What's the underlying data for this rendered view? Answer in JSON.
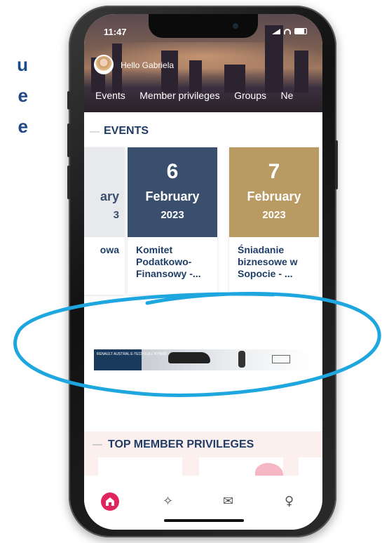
{
  "side_text": [
    "u",
    "e",
    "e"
  ],
  "status": {
    "time": "11:47"
  },
  "header": {
    "greeting": "Hello Gabriela"
  },
  "nav": [
    "Events",
    "Member privileges",
    "Groups",
    "Ne"
  ],
  "events": {
    "title": "EVENTS",
    "cards": [
      {
        "day": "",
        "month": "ary",
        "year": "3",
        "title": "owa",
        "bg": "#e8e9ec"
      },
      {
        "day": "6",
        "month": "February",
        "year": "2023",
        "title": "Komitet Podatkowo-Finansowy -...",
        "bg": "#3a4f6e"
      },
      {
        "day": "7",
        "month": "February",
        "year": "2023",
        "title": "Śniadanie biznesowe w Sopocie - ...",
        "bg": "#b89a62"
      }
    ]
  },
  "ad": {
    "text": "RENAULT AUSTRAL E-TECH FULL HYBRID"
  },
  "privileges": {
    "title": "TOP MEMBER PRIVILEGES"
  },
  "tabs": [
    "home-icon",
    "network-icon",
    "mail-icon",
    "user-icon"
  ],
  "colors": {
    "accent": "#e0245e",
    "navy": "#1f3d66",
    "circle": "#1ea6df"
  }
}
